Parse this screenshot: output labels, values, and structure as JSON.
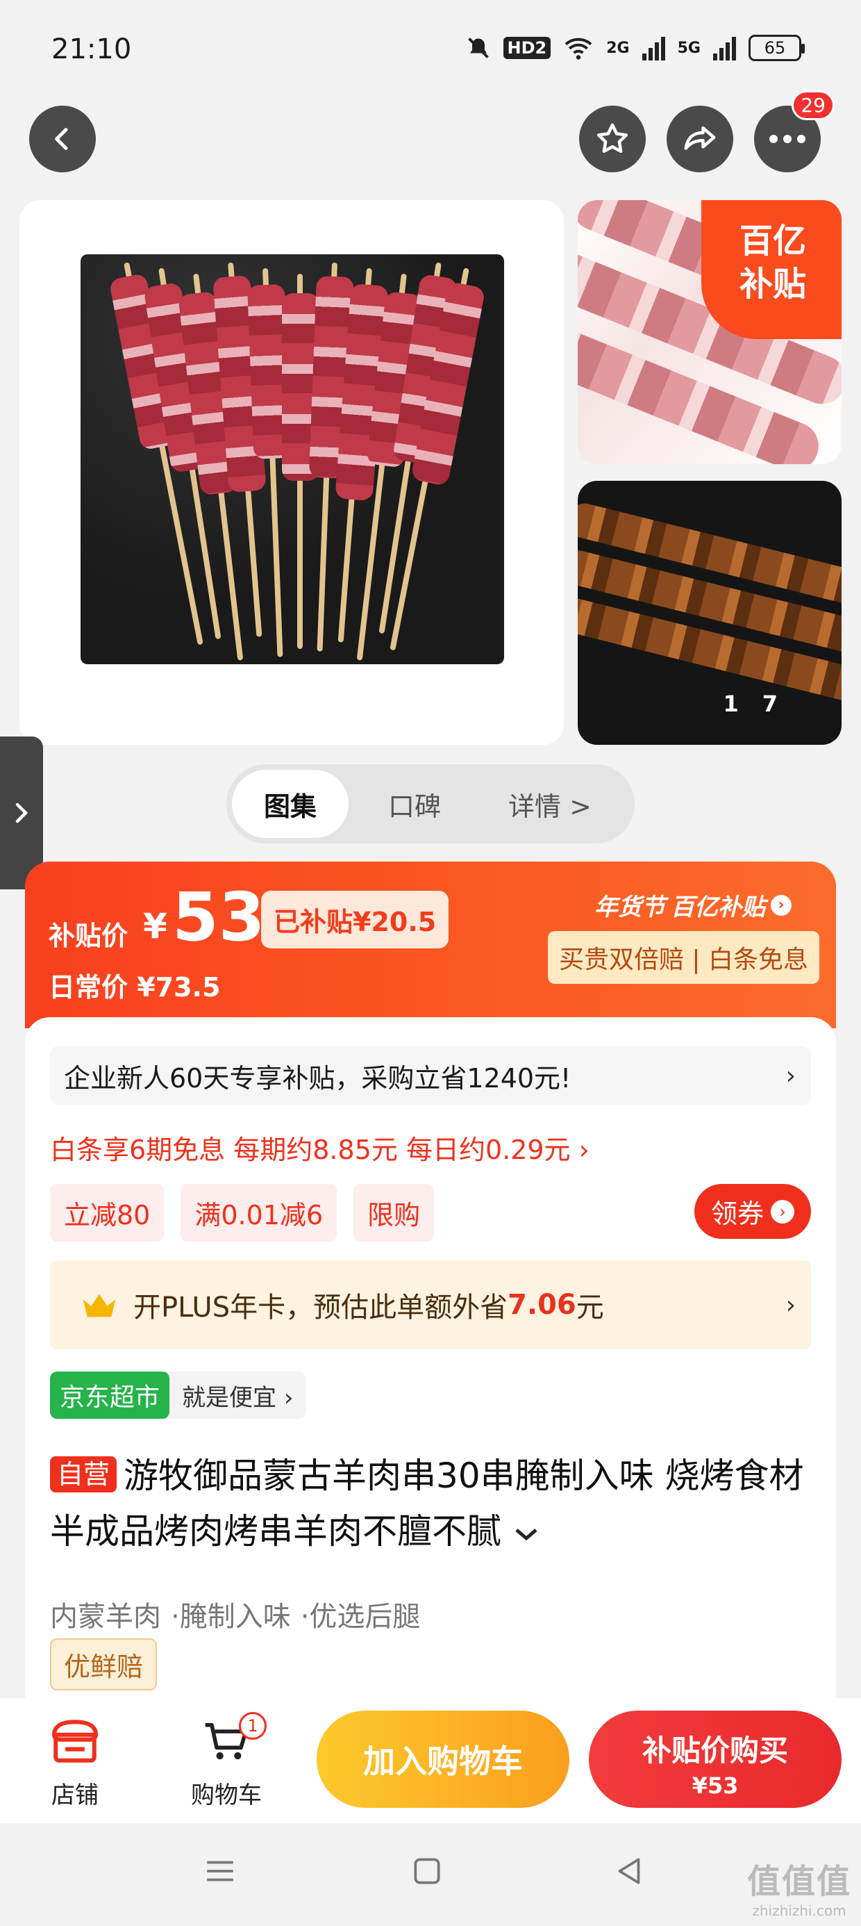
{
  "status_bar": {
    "time": "21:10",
    "hd_label": "HD2",
    "signal_2g": "2G",
    "signal_5g": "5G",
    "battery": "65"
  },
  "top_nav": {
    "back_icon": "chevron-left-icon",
    "favorite_icon": "star-icon",
    "share_icon": "share-icon",
    "more_icon": "more-dots-icon",
    "message_badge": "29"
  },
  "gallery": {
    "subsidy_tag_line1": "百亿",
    "subsidy_tag_line2": "补贴",
    "page_current": "1",
    "page_total": "7"
  },
  "tabs": [
    {
      "label": "图集"
    },
    {
      "label": "口碑"
    },
    {
      "label": "详情 >"
    }
  ],
  "price_banner": {
    "subsidy_label": "补贴价",
    "currency": "¥",
    "price": "53",
    "saved": "已补贴¥20.5",
    "daily_price": "日常价 ¥73.5",
    "event": "年货节",
    "brand": "百亿补贴",
    "guarantee": "买贵双倍赔 | 白条免息",
    "accent_color": "#f8401f"
  },
  "promotions": {
    "enterprise": "企业新人60天专享补贴，采购立省1240元!",
    "baitiao": "白条享6期免息 每期约8.85元 每日约0.29元 ›",
    "chips": [
      "立减80",
      "满0.01减6",
      "限购"
    ],
    "coupon_button": "领券",
    "plus_prefix": "开PLUS年卡，预估此单额外省",
    "plus_amount": "7.06",
    "plus_suffix": "元"
  },
  "store_tag": {
    "name": "京东超市",
    "slogan": "就是便宜 ›"
  },
  "product": {
    "self_operated": "自营",
    "title": "游牧御品蒙古羊肉串30串腌制入味 烧烤食材半成品烤肉烤串羊肉不膻不腻",
    "features": [
      "内蒙羊肉",
      "·腌制入味",
      "·优选后腿"
    ],
    "fresh_badge": "优鲜赔"
  },
  "bottom_bar": {
    "store_label": "店铺",
    "cart_label": "购物车",
    "cart_count": "1",
    "add_to_cart": "加入购物车",
    "buy_line1": "补贴价购买",
    "buy_line2": "¥53"
  },
  "watermark": {
    "line1": "值值值",
    "line2": "zhizhizhi.com"
  }
}
